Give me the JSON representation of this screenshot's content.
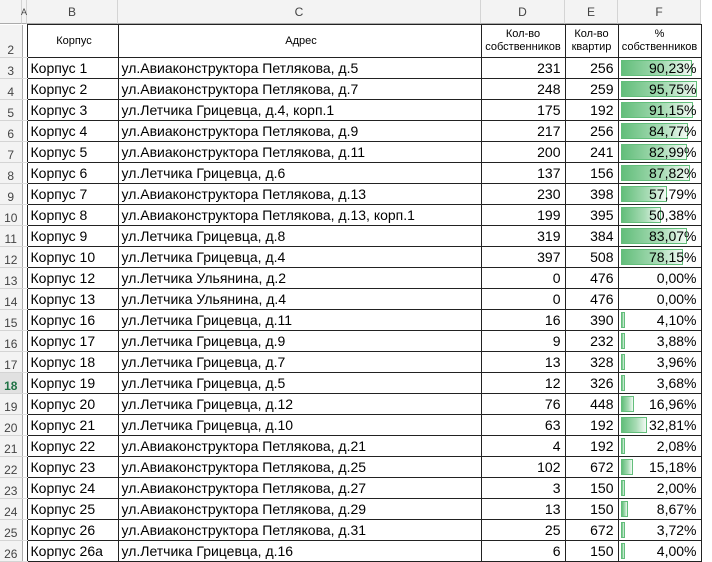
{
  "columns": {
    "a": "A",
    "b": "B",
    "c": "C",
    "d": "D",
    "e": "E",
    "f": "F"
  },
  "header_row": {
    "num": "2",
    "b": "Корпус",
    "c": "Адрес",
    "d": "Кол-во собственников",
    "e": "Кол-во квартир",
    "f": "% собственников"
  },
  "selected_row": "18",
  "bar_color": "#63be7b",
  "rows": [
    {
      "num": "3",
      "b": "Корпус 1",
      "c": "ул.Авиаконструктора Петлякова, д.5",
      "d": "231",
      "e": "256",
      "f": "90,23%",
      "pct": 90.23
    },
    {
      "num": "4",
      "b": "Корпус 2",
      "c": "ул.Авиаконструктора Петлякова, д.7",
      "d": "248",
      "e": "259",
      "f": "95,75%",
      "pct": 95.75
    },
    {
      "num": "5",
      "b": "Корпус 3",
      "c": "ул.Летчика Грицевца, д.4, корп.1",
      "d": "175",
      "e": "192",
      "f": "91,15%",
      "pct": 91.15
    },
    {
      "num": "6",
      "b": "Корпус 4",
      "c": "ул.Авиаконструктора Петлякова, д.9",
      "d": "217",
      "e": "256",
      "f": "84,77%",
      "pct": 84.77
    },
    {
      "num": "7",
      "b": "Корпус 5",
      "c": "ул.Авиаконструктора Петлякова, д.11",
      "d": "200",
      "e": "241",
      "f": "82,99%",
      "pct": 82.99
    },
    {
      "num": "8",
      "b": "Корпус 6",
      "c": "ул.Летчика Грицевца, д.6",
      "d": "137",
      "e": "156",
      "f": "87,82%",
      "pct": 87.82
    },
    {
      "num": "9",
      "b": "Корпус 7",
      "c": "ул.Авиаконструктора Петлякова, д.13",
      "d": "230",
      "e": "398",
      "f": "57,79%",
      "pct": 57.79
    },
    {
      "num": "10",
      "b": "Корпус 8",
      "c": "ул.Авиаконструктора Петлякова, д.13, корп.1",
      "d": "199",
      "e": "395",
      "f": "50,38%",
      "pct": 50.38
    },
    {
      "num": "11",
      "b": "Корпус 9",
      "c": "ул.Летчика Грицевца, д.8",
      "d": "319",
      "e": "384",
      "f": "83,07%",
      "pct": 83.07
    },
    {
      "num": "12",
      "b": "Корпус 10",
      "c": "ул.Летчика Грицевца, д.4",
      "d": "397",
      "e": "508",
      "f": "78,15%",
      "pct": 78.15
    },
    {
      "num": "13",
      "b": "Корпус 12",
      "c": "ул.Летчика Ульянина, д.2",
      "d": "0",
      "e": "476",
      "f": "0,00%",
      "pct": 0
    },
    {
      "num": "14",
      "b": "Корпус 13",
      "c": "ул.Летчика Ульянина, д.4",
      "d": "0",
      "e": "476",
      "f": "0,00%",
      "pct": 0
    },
    {
      "num": "15",
      "b": "Корпус 16",
      "c": "ул.Летчика Грицевца, д.11",
      "d": "16",
      "e": "390",
      "f": "4,10%",
      "pct": 4.1
    },
    {
      "num": "16",
      "b": "Корпус 17",
      "c": "ул.Летчика Грицевца, д.9",
      "d": "9",
      "e": "232",
      "f": "3,88%",
      "pct": 3.88
    },
    {
      "num": "17",
      "b": "Корпус 18",
      "c": "ул.Летчика Грицевца, д.7",
      "d": "13",
      "e": "328",
      "f": "3,96%",
      "pct": 3.96
    },
    {
      "num": "18",
      "b": "Корпус 19",
      "c": "ул.Летчика Грицевца, д.5",
      "d": "12",
      "e": "326",
      "f": "3,68%",
      "pct": 3.68
    },
    {
      "num": "19",
      "b": "Корпус 20",
      "c": "ул.Летчика Грицевца, д.12",
      "d": "76",
      "e": "448",
      "f": "16,96%",
      "pct": 16.96
    },
    {
      "num": "20",
      "b": "Корпус 21",
      "c": "ул.Летчика Грицевца, д.10",
      "d": "63",
      "e": "192",
      "f": "32,81%",
      "pct": 32.81
    },
    {
      "num": "21",
      "b": "Корпус 22",
      "c": "ул.Авиаконструктора Петлякова, д.21",
      "d": "4",
      "e": "192",
      "f": "2,08%",
      "pct": 2.08
    },
    {
      "num": "22",
      "b": "Корпус 23",
      "c": "ул.Авиаконструктора Петлякова, д.25",
      "d": "102",
      "e": "672",
      "f": "15,18%",
      "pct": 15.18
    },
    {
      "num": "23",
      "b": "Корпус 24",
      "c": "ул.Авиаконструктора Петлякова, д.27",
      "d": "3",
      "e": "150",
      "f": "2,00%",
      "pct": 2.0
    },
    {
      "num": "24",
      "b": "Корпус 25",
      "c": "ул.Авиаконструктора Петлякова, д.29",
      "d": "13",
      "e": "150",
      "f": "8,67%",
      "pct": 8.67
    },
    {
      "num": "25",
      "b": "Корпус 26",
      "c": "ул.Авиаконструктора Петлякова, д.31",
      "d": "25",
      "e": "672",
      "f": "3,72%",
      "pct": 3.72
    },
    {
      "num": "26",
      "b": "Корпус 26а",
      "c": "ул.Летчика Грицевца, д.16",
      "d": "6",
      "e": "150",
      "f": "4,00%",
      "pct": 4.0
    }
  ]
}
